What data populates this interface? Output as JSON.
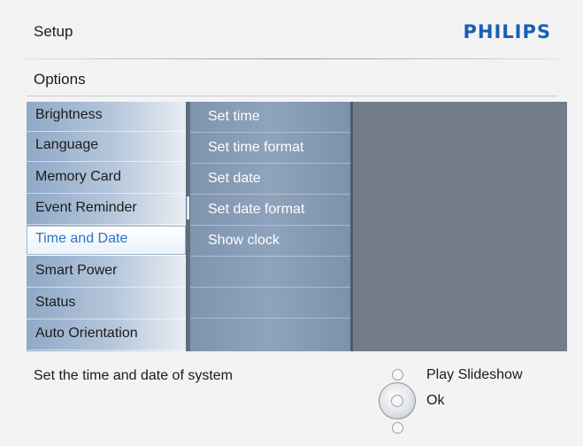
{
  "header": {
    "title": "Setup",
    "brand": "PHILIPS",
    "brand_color": "#1a5fb4"
  },
  "section": {
    "title": "Options"
  },
  "left_menu": {
    "items": [
      {
        "label": "Brightness"
      },
      {
        "label": "Language"
      },
      {
        "label": "Memory Card"
      },
      {
        "label": "Event Reminder"
      },
      {
        "label": "Time and Date",
        "selected": true
      },
      {
        "label": "Smart Power"
      },
      {
        "label": "Status"
      },
      {
        "label": "Auto Orientation"
      }
    ]
  },
  "sub_menu": {
    "items": [
      {
        "label": "Set time"
      },
      {
        "label": "Set time format"
      },
      {
        "label": "Set date"
      },
      {
        "label": "Set date format"
      },
      {
        "label": "Show clock"
      },
      {
        "label": ""
      },
      {
        "label": ""
      },
      {
        "label": ""
      }
    ]
  },
  "footer": {
    "description": "Set the time and date of system",
    "hints": {
      "play": "Play Slideshow",
      "ok": "Ok"
    }
  },
  "icons": [
    "nav-up-button-icon",
    "nav-ok-ring-icon",
    "nav-down-button-icon"
  ]
}
